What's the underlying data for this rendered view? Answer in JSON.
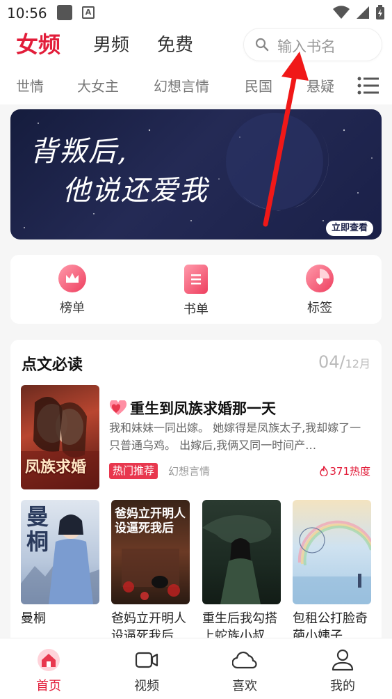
{
  "status_bar": {
    "time": "10:56"
  },
  "header": {
    "tabs": [
      {
        "label": "女频",
        "active": true
      },
      {
        "label": "男频",
        "active": false
      },
      {
        "label": "免费",
        "active": false
      }
    ],
    "search_placeholder": "输入书名"
  },
  "categories": [
    "世情",
    "大女主",
    "幻想言情",
    "民国",
    "悬疑"
  ],
  "banner": {
    "title_line1": "背叛后,",
    "title_line2": "他说还爱我",
    "button": "立即查看"
  },
  "quick_entries": [
    {
      "label": "榜单",
      "icon": "crown-icon"
    },
    {
      "label": "书单",
      "icon": "booklist-icon"
    },
    {
      "label": "标签",
      "icon": "tag-pie-icon"
    }
  ],
  "section": {
    "title": "点文必读",
    "date_day": "04",
    "date_month": "12月",
    "featured": {
      "title": "重生到凤族求婚那一天",
      "description": "我和妹妹一同出嫁。 她嫁得是凤族太子,我却嫁了一只普通乌鸡。 出嫁后,我俩又同一时间产…",
      "tag": "热门推荐",
      "genre": "幻想言情",
      "heat": "371热度",
      "cover_text": "凤族求婚"
    },
    "books": [
      {
        "title": "曼桐",
        "cover_text": "曼桐"
      },
      {
        "title": "爸妈立开明人设逼死我后…",
        "cover_text": "爸妈立开明人设逼死我后"
      },
      {
        "title": "重生后我勾搭上蛇族小叔…",
        "cover_text": ""
      },
      {
        "title": "包租公打脸奇葩小姨子",
        "cover_text": ""
      }
    ]
  },
  "bottom_nav": [
    {
      "label": "首页",
      "active": true,
      "icon": "home-icon"
    },
    {
      "label": "视频",
      "active": false,
      "icon": "video-icon"
    },
    {
      "label": "喜欢",
      "active": false,
      "icon": "cloud-icon"
    },
    {
      "label": "我的",
      "active": false,
      "icon": "profile-icon"
    }
  ],
  "colors": {
    "accent": "#e21d3a",
    "banner_bg": "#1a2048"
  }
}
